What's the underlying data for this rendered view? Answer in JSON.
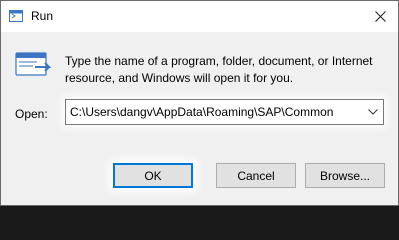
{
  "window": {
    "title": "Run",
    "icon": "run-app-icon",
    "close_icon": "close-icon"
  },
  "dialog": {
    "description": "Type the name of a program, folder, document, or Internet resource, and Windows will open it for you.",
    "open_label": "Open:",
    "open_value": "C:\\Users\\dangv\\AppData\\Roaming\\SAP\\Common"
  },
  "buttons": {
    "ok": "OK",
    "cancel": "Cancel",
    "browse": "Browse..."
  },
  "colors": {
    "accent": "#0078d7",
    "dialog_bg": "#f0f0f0",
    "titlebar_bg": "#ffffff"
  }
}
